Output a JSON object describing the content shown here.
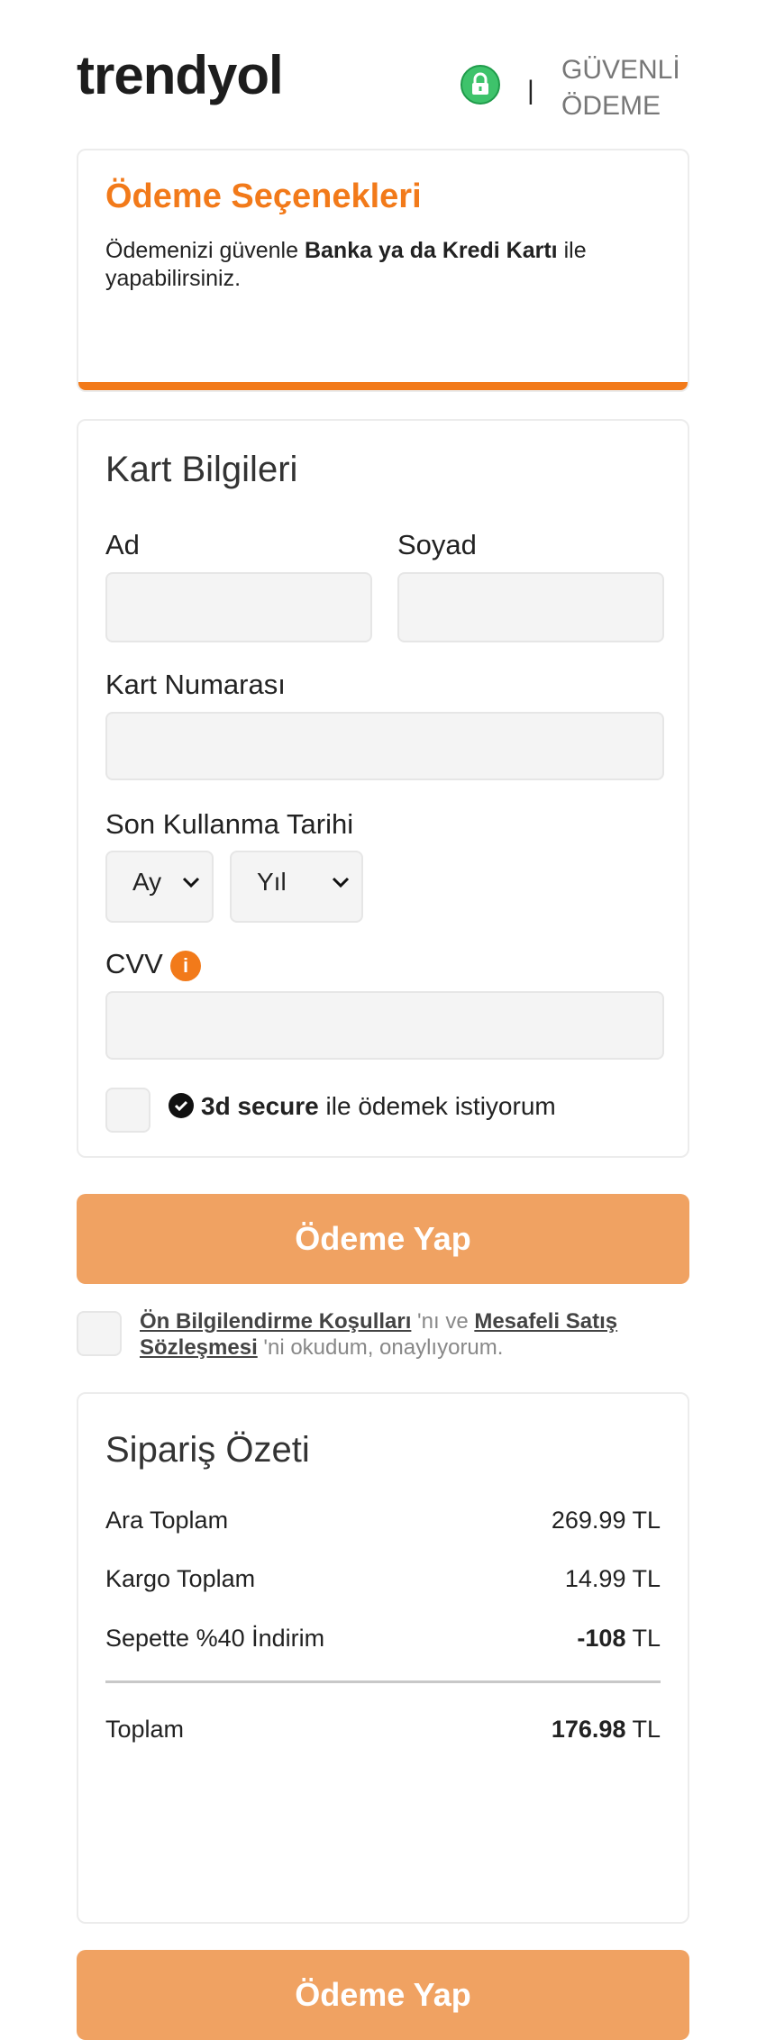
{
  "header": {
    "brand": "trendyol",
    "separator": "|",
    "secure_label": "GÜVENLİ ÖDEME",
    "lock_icon": "lock-icon"
  },
  "payment_options": {
    "title": "Ödeme Seçenekleri",
    "desc_prefix": "Ödemenizi güvenle ",
    "desc_bold": "Banka ya da Kredi Kartı",
    "desc_suffix": " ile yapabilirsiniz."
  },
  "card_info": {
    "title": "Kart Bilgileri",
    "first_name_label": "Ad",
    "last_name_label": "Soyad",
    "card_number_label": "Kart Numarası",
    "expiry_label": "Son Kullanma Tarihi",
    "month_select": "Ay",
    "year_select": "Yıl",
    "cvv_label": "CVV",
    "info_glyph": "i",
    "secure3d_bold": "3d secure",
    "secure3d_text": " ile ödemek istiyorum"
  },
  "pay_button": "Ödeme Yap",
  "terms": {
    "link1": "Ön Bilgilendirme Koşulları",
    "mid": " 'nı ve ",
    "link2": "Mesafeli Satış Sözleşmesi",
    "suffix": " 'ni okudum, onaylıyorum."
  },
  "summary": {
    "title": "Sipariş Özeti",
    "rows": [
      {
        "label": "Ara Toplam",
        "value": "269.99",
        "unit": " TL"
      },
      {
        "label": "Kargo Toplam",
        "value": "14.99",
        "unit": " TL"
      },
      {
        "label": "Sepette %40 İndirim",
        "value": "-108",
        "unit": " TL"
      }
    ],
    "total_label": "Toplam",
    "total_value": "176.98",
    "total_unit": " TL"
  },
  "colors": {
    "accent": "#f27a1a",
    "button": "#f0a262",
    "secure_green": "#3ec36b"
  }
}
